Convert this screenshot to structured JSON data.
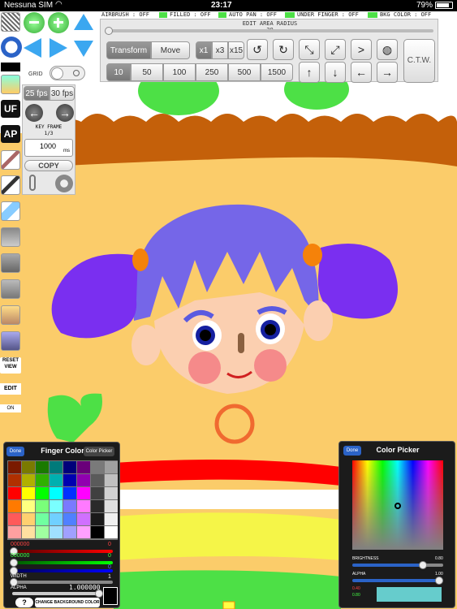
{
  "status_bar": {
    "carrier": "Nessuna SIM",
    "time": "23:17",
    "battery": "79%"
  },
  "top_flags": {
    "airbrush": "AIRBRUSH : OFF",
    "filled": "FILLED : OFF",
    "auto_pan": "AUTO PAN : OFF",
    "under_finger": "UNDER FINGER : OFF",
    "bkg_color": "BKG COLOR : OFF"
  },
  "edit_area": {
    "title": "EDIT AREA RADIUS",
    "value": "30"
  },
  "mode_tabs": [
    {
      "label": "Transform"
    },
    {
      "label": "Move"
    }
  ],
  "multipliers": [
    {
      "label": "x1"
    },
    {
      "label": "x3"
    },
    {
      "label": "x15"
    }
  ],
  "step_values": [
    {
      "label": "10"
    },
    {
      "label": "50"
    },
    {
      "label": "100"
    },
    {
      "label": "250"
    },
    {
      "label": "500"
    },
    {
      "label": "1500"
    }
  ],
  "ctw_label": "C.T.W.",
  "left_toolbar": {
    "grid_label": "GRID",
    "uf_label": "UF",
    "ap_label": "AP",
    "reset_view": "RESET VIEW",
    "edit_label": "EDIT",
    "edit_state": "ON"
  },
  "frames_panel": {
    "fps_options": [
      {
        "label": "25 fps"
      },
      {
        "label": "30 fps"
      }
    ],
    "keyframe_label": "KEY FRAME",
    "keyframe_value": "1/3",
    "duration_value": "1000",
    "duration_unit": "ms",
    "copy_label": "COPY"
  },
  "finger_color": {
    "done": "Done",
    "title": "Finger Color",
    "color_picker_btn": "Color Picker",
    "red_hex": "000000",
    "red_val": "0",
    "green_hex": "000000",
    "green_val": "0",
    "blue_val": "0",
    "width_label": "WIDTH",
    "width_val": "1",
    "alpha_label": "ALPHA",
    "alpha_val": "1.000000",
    "help": "?",
    "change_bg": "CHANGE BACKGROUND COLOR",
    "palette": [
      "#7a1a00",
      "#7a7a00",
      "#1a7a00",
      "#007a7a",
      "#00007a",
      "#6a007a",
      "#7a7a7a",
      "#a0a0a0",
      "#b03000",
      "#b0b000",
      "#30b000",
      "#00b0b0",
      "#0000b0",
      "#9000b0",
      "#5a5a5a",
      "#c0c0c0",
      "#ff0000",
      "#ffff00",
      "#00ff00",
      "#00ffff",
      "#0030ff",
      "#ff00ff",
      "#404040",
      "#d0d0d0",
      "#ff7a00",
      "#ffff80",
      "#7aff7a",
      "#7affff",
      "#7a7aff",
      "#ff7aff",
      "#2a2a2a",
      "#e0e0e0",
      "#ff5a5a",
      "#ffd070",
      "#70ffa0",
      "#70d0ff",
      "#5080ff",
      "#d070ff",
      "#1a1a1a",
      "#f0f0f0",
      "#ffa0a0",
      "#ffe0a0",
      "#a0ffa0",
      "#a0e0ff",
      "#a0a0ff",
      "#ffa0ff",
      "#000000",
      "#ffffff"
    ]
  },
  "color_picker": {
    "done": "Done",
    "title": "Color Picker",
    "brightness_label": "BRIGHTNESS",
    "brightness_val": "0.80",
    "alpha_label": "ALPHA",
    "alpha_val": "1.00",
    "r_val": "0.40",
    "g_val": "0.80",
    "preview_color": "#66cccc"
  },
  "colors": {
    "bg_sand": "#fbcc6a",
    "sky": "#ffffff",
    "hill": "#c4600a",
    "hair": "#7566e8",
    "ponytail": "#7a2ff0",
    "accent_blue": "#2b63c7"
  }
}
